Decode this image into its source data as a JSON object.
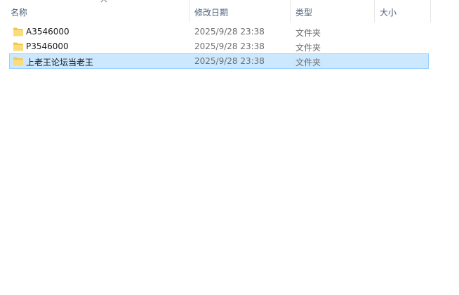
{
  "columns": {
    "name": "名称",
    "date": "修改日期",
    "type": "类型",
    "size": "大小"
  },
  "sort": {
    "column": "name",
    "icon": "chevron-up-icon"
  },
  "colors": {
    "selection_fill": "#cce8ff",
    "selection_border": "#99d1ff",
    "folder": "#f7d774",
    "header_text": "#4c607a"
  },
  "files": [
    {
      "name": "A3546000",
      "date": "2025/9/28 23:38",
      "type": "文件夹",
      "size": "",
      "icon": "folder-icon",
      "selected": false
    },
    {
      "name": "P3546000",
      "date": "2025/9/28 23:38",
      "type": "文件夹",
      "size": "",
      "icon": "folder-icon",
      "selected": false
    },
    {
      "name": "上老王论坛当老王",
      "date": "2025/9/28 23:38",
      "type": "文件夹",
      "size": "",
      "icon": "folder-icon",
      "selected": true
    }
  ]
}
